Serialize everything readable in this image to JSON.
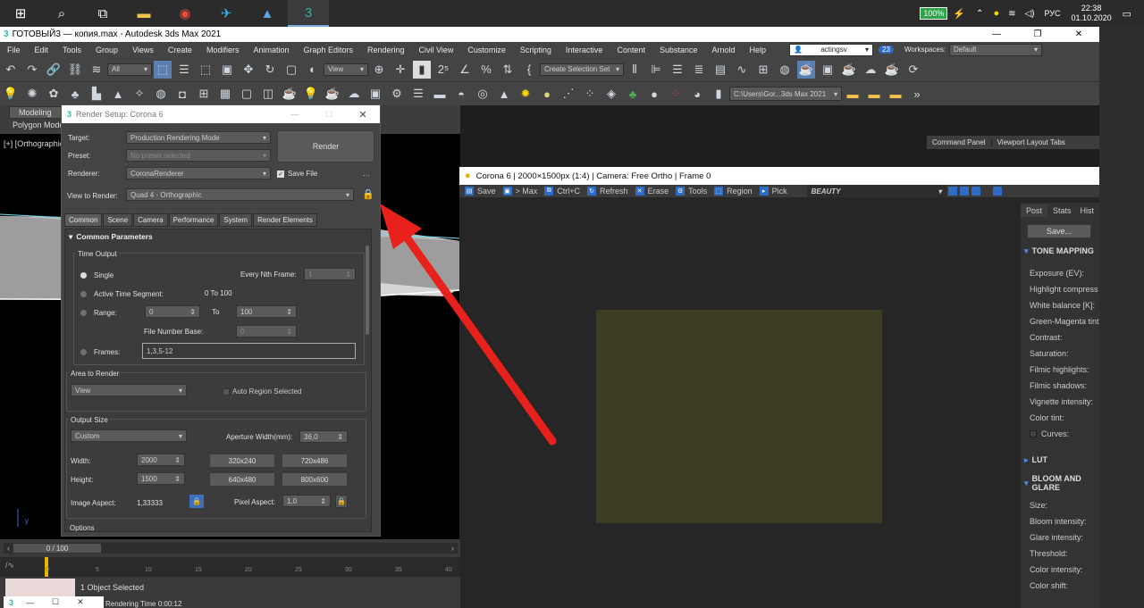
{
  "taskbar": {
    "battery": "100%",
    "lang": "РУС",
    "time": "22:38",
    "date": "01.10.2020"
  },
  "window": {
    "title": "ГОТОВЫЙ3 — копия.max - Autodesk 3ds Max 2021"
  },
  "menu": [
    "File",
    "Edit",
    "Tools",
    "Group",
    "Views",
    "Create",
    "Modifiers",
    "Animation",
    "Graph Editors",
    "Rendering",
    "Civil View",
    "Customize",
    "Scripting",
    "Interactive",
    "Content",
    "Substance",
    "Arnold",
    "Help"
  ],
  "account": {
    "user": "actingsv",
    "count": "23",
    "workspaces_label": "Workspaces:",
    "workspace": "Default"
  },
  "toolbar": {
    "filter": "All",
    "view": "View",
    "selection_set": "Create Selection Set",
    "path": "C:\\Users\\Gor...3ds Max 2021"
  },
  "left": {
    "modeling": "Modeling",
    "polygon": "Polygon Modeling",
    "viewport_label": "[+] [Orthographic"
  },
  "render_setup": {
    "title": "Render Setup: Corona 6",
    "target_label": "Target:",
    "target": "Production Rendering Mode",
    "preset_label": "Preset:",
    "preset": "No preset selected",
    "renderer_label": "Renderer:",
    "renderer": "CoronaRenderer",
    "save_file": "Save File",
    "render_btn": "Render",
    "view_label": "View to Render:",
    "view": "Quad 4 - Orthographic",
    "tabs": [
      "Common",
      "Scene",
      "Camera",
      "Performance",
      "System",
      "Render Elements"
    ],
    "rollout": "Common Parameters",
    "time_output": "Time Output",
    "single": "Single",
    "every_nth": "Every Nth Frame:",
    "every_nth_val": "1",
    "active_segment": "Active Time Segment:",
    "active_range": "0 To 100",
    "range": "Range:",
    "range_from": "0",
    "range_to_label": "To",
    "range_to": "100",
    "file_number_base": "File Number Base:",
    "file_number_val": "0",
    "frames": "Frames:",
    "frames_val": "1,3,5-12",
    "area_to_render": "Area to Render",
    "area_val": "View",
    "auto_region": "Auto Region Selected",
    "output_size": "Output Size",
    "output_preset": "Custom",
    "aperture_label": "Aperture Width(mm):",
    "aperture_val": "36,0",
    "width_label": "Width:",
    "width_val": "2000",
    "height_label": "Height:",
    "height_val": "1500",
    "presets": [
      "320x240",
      "720x486",
      "640x480",
      "800x600"
    ],
    "image_aspect_label": "Image Aspect:",
    "image_aspect": "1,33333",
    "pixel_aspect_label": "Pixel Aspect:",
    "pixel_aspect": "1,0",
    "options": "Options"
  },
  "command_panel": {
    "tab1": "Command Panel",
    "tab2": "Viewport Layout Tabs"
  },
  "corona": {
    "title": "Corona 6 | 2000×1500px (1:4) | Camera: Free Ortho | Frame 0",
    "tools": [
      "Save",
      "> Max",
      "Ctrl+C",
      "Refresh",
      "Erase",
      "Tools",
      "Region",
      "Pick"
    ],
    "channel": "BEAUTY",
    "post_tabs": [
      "Post",
      "Stats",
      "Hist"
    ],
    "save": "Save...",
    "tone_mapping": "TONE MAPPING",
    "tone_items": [
      "Exposure (EV):",
      "Highlight compress",
      "White balance [K]:",
      "Green-Magenta tint",
      "Contrast:",
      "Saturation:",
      "Filmic highlights:",
      "Filmic shadows:",
      "Vignette intensity:",
      "Color tint:",
      "Curves:"
    ],
    "lut": "LUT",
    "bloom": "BLOOM AND GLARE",
    "bloom_items": [
      "Size:",
      "Bloom intensity:",
      "Glare intensity:",
      "Threshold:",
      "Color intensity:",
      "Color shift:"
    ],
    "render_color": "#3d3d24"
  },
  "timeline": {
    "frame": "0 / 100",
    "ticks": [
      "0",
      "5",
      "10",
      "15",
      "20",
      "25",
      "30",
      "35",
      "40"
    ],
    "status": "1 Object Selected",
    "render_time": "Rendering Time  0:00:12"
  },
  "colors": {
    "arrow": "#e8211d",
    "accent": "#2d6bc4"
  }
}
